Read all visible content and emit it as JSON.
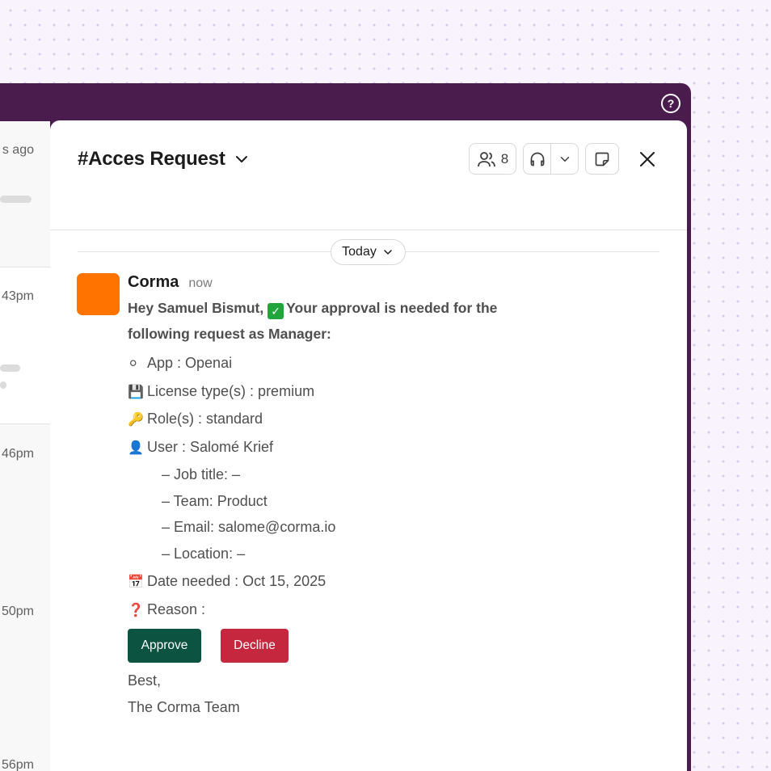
{
  "left_list": {
    "timestamps": [
      "s ago",
      "43pm",
      "46pm",
      "50pm",
      "56pm"
    ]
  },
  "channel": {
    "title": "#Acces Request",
    "member_count": "8"
  },
  "divider": {
    "label": "Today"
  },
  "message": {
    "sender": "Corma",
    "time": "now",
    "greeting": "Hey Samuel Bismut,",
    "greeting_rest": "Your approval is needed for the",
    "greeting_line2": "following request as Manager:",
    "items": {
      "app": "App : Openai",
      "license": "License type(s) : premium",
      "role": "Role(s) : standard",
      "user": "User : Salomé Krief",
      "job_title": "– Job title: –",
      "team": "– Team: Product",
      "email": "– Email: salome@corma.io",
      "location": "– Location: –",
      "date_needed": "Date needed : Oct 15, 2025",
      "reason": "Reason :"
    },
    "emojis": {
      "app": "⚪",
      "license": "💾",
      "role": "🔑",
      "user": "👤",
      "date_needed": "📅",
      "reason": "❓",
      "check": "✓"
    },
    "buttons": {
      "approve": "Approve",
      "decline": "Decline"
    },
    "signoff": "Best,",
    "signature": "The Corma Team"
  },
  "colors": {
    "frame": "#4a1c4d",
    "avatar": "#ff7400",
    "approve": "#0c5341",
    "decline": "#c5273f"
  }
}
